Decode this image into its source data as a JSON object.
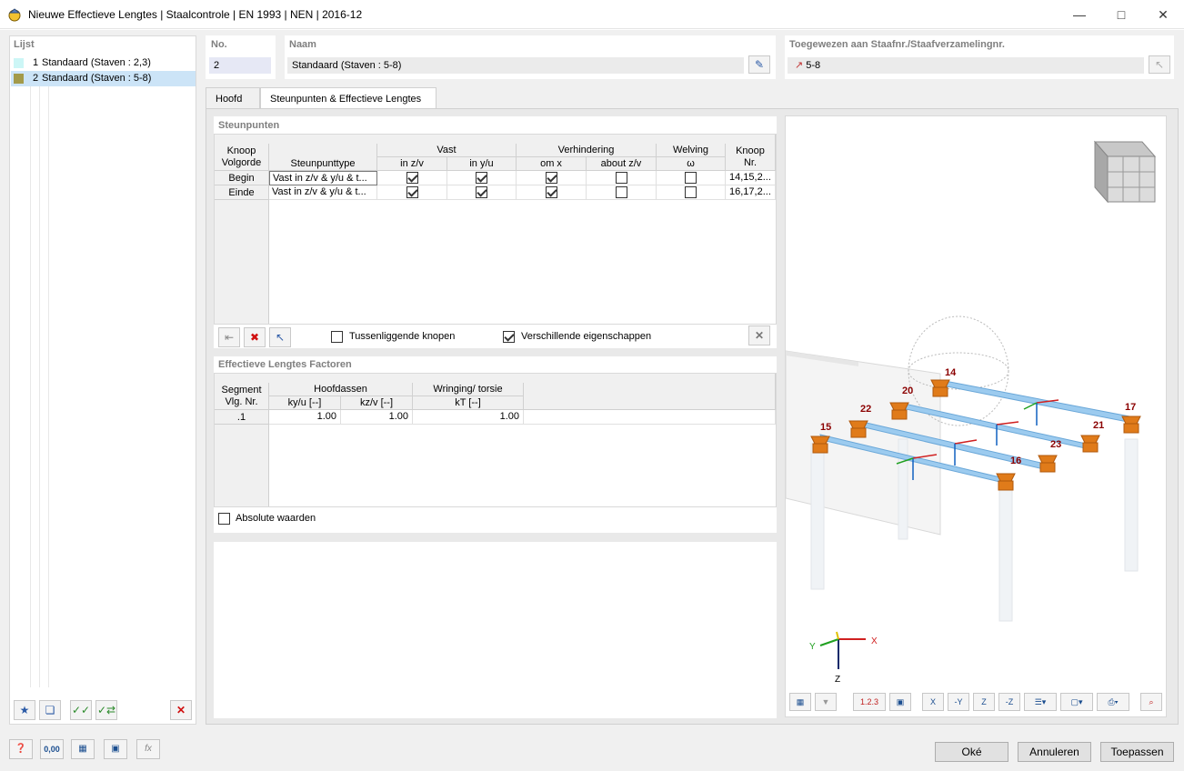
{
  "window": {
    "title": "Nieuwe Effectieve Lengtes | Staalcontrole | EN 1993 | NEN | 2016-12"
  },
  "lijst": {
    "header": "Lijst",
    "items": [
      {
        "num": "1",
        "label": "Standaard (Staven : 2,3)",
        "color": "#ccf6f6"
      },
      {
        "num": "2",
        "label": "Standaard (Staven : 5-8)",
        "color": "#a39a4a"
      }
    ]
  },
  "no": {
    "label": "No.",
    "value": "2"
  },
  "naam": {
    "label": "Naam",
    "value": "Standaard (Staven : 5-8)"
  },
  "toegewezen": {
    "label": "Toegewezen aan Staafnr./Staafverzamelingnr.",
    "value": "5-8"
  },
  "tabs": [
    "Hoofd",
    "Steunpunten & Effectieve Lengtes"
  ],
  "steunpunten": {
    "title": "Steunpunten",
    "headers": {
      "knoop_volgorde": "Knoop\nVolgorde",
      "steunpunttype": "Steunpunttype",
      "vast": "Vast",
      "in_zv": "in z/v",
      "in_yu": "in y/u",
      "verhindering": "Verhindering",
      "om_x": "om x",
      "about_zv": "about z/v",
      "welving": "Welving",
      "omega": "ω",
      "knoop_nr": "Knoop\nNr."
    },
    "rows": [
      {
        "label": "Begin",
        "type": "Vast in z/v & y/u & t...",
        "in_zv": true,
        "in_yu": true,
        "om_x": true,
        "about_zv": false,
        "welving": false,
        "knoop": "14,15,2..."
      },
      {
        "label": "Einde",
        "type": "Vast in z/v & y/u & t...",
        "in_zv": true,
        "in_yu": true,
        "om_x": true,
        "about_zv": false,
        "welving": false,
        "knoop": "16,17,2..."
      }
    ],
    "tussenliggende": {
      "label": "Tussenliggende knopen",
      "checked": false
    },
    "verschillende": {
      "label": "Verschillende eigenschappen",
      "checked": true
    }
  },
  "efflengtes": {
    "title": "Effectieve Lengtes Factoren",
    "headers": {
      "segment": "Segment\nVlg. Nr.",
      "hoofdassen": "Hoofdassen",
      "kyu": "ky/u [--]",
      "kzv": "kz/v [--]",
      "wringing": "Wringing/ torsie",
      "kt": "kT [--]"
    },
    "rows": [
      {
        "label": ".1",
        "kyu": "1.00",
        "kzv": "1.00",
        "kt": "1.00"
      }
    ],
    "absolute": {
      "label": "Absolute waarden",
      "checked": false
    }
  },
  "view3d": {
    "node_labels": [
      "14",
      "20",
      "22",
      "15",
      "17",
      "21",
      "23",
      "16"
    ],
    "axis_labels": {
      "x": "X",
      "y": "Y",
      "z": "Z",
      "lx": "x",
      "ly": "y",
      "lz": "z"
    },
    "toolbar_labels": {
      "numbering": "1.2.3",
      "dir_x": "X",
      "dir_neg_y": "-Y",
      "dir_z": "Z",
      "dir_neg_z": "-Z"
    }
  },
  "bottom_icons": {
    "decimal": "0,00",
    "formula": "fx"
  },
  "footer": {
    "ok": "Oké",
    "cancel": "Annuleren",
    "apply": "Toepassen"
  },
  "colors": {
    "selection": "#cce4f7",
    "beam": "#9ccbef",
    "support": "#e07b1a",
    "node_text": "#8b0000"
  }
}
